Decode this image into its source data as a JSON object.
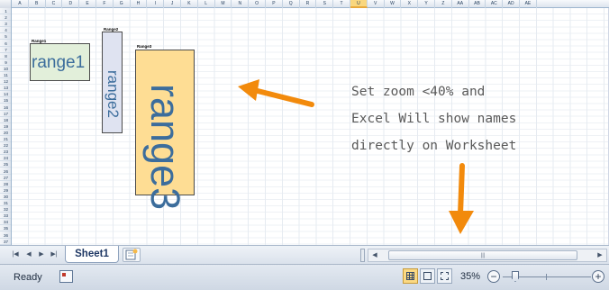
{
  "columns": [
    "A",
    "B",
    "C",
    "D",
    "E",
    "F",
    "G",
    "H",
    "I",
    "J",
    "K",
    "L",
    "M",
    "N",
    "O",
    "P",
    "Q",
    "R",
    "S",
    "T",
    "U",
    "V",
    "W",
    "X",
    "Y",
    "Z",
    "AA",
    "AB",
    "AC",
    "AD",
    "AE"
  ],
  "active_column": "U",
  "rows": [
    "1",
    "2",
    "3",
    "4",
    "5",
    "6",
    "7",
    "8",
    "9",
    "10",
    "11",
    "12",
    "13",
    "14",
    "15",
    "16",
    "17",
    "18",
    "19",
    "20",
    "21",
    "22",
    "23",
    "24",
    "25",
    "26",
    "27",
    "28",
    "29",
    "30",
    "31",
    "32",
    "33",
    "34",
    "35",
    "36",
    "37"
  ],
  "named_ranges": [
    {
      "label": "Range1",
      "text": "range1",
      "fill": "#e2efda"
    },
    {
      "label": "Range2",
      "text": "range2",
      "fill": "#dfe3f1"
    },
    {
      "label": "Range3",
      "text": "range3",
      "fill": "#fedd94"
    }
  ],
  "note": {
    "line1": "Set zoom <40% and",
    "line2": "Excel Will show names",
    "line3": "directly on Worksheet",
    "color": "#595959"
  },
  "arrow_color": "#f28a0c",
  "tabs": {
    "first_icon": "first-sheet-icon",
    "prev_icon": "prev-sheet-icon",
    "next_icon": "next-sheet-icon",
    "last_icon": "last-sheet-icon",
    "sheet_name": "Sheet1",
    "new_sheet_icon": "insert-sheet-icon",
    "scroll_grip": "|||"
  },
  "status": {
    "ready": "Ready",
    "zoom": "35%",
    "zoom_out": "−",
    "zoom_in": "+",
    "zoom_fraction": 0.35
  }
}
